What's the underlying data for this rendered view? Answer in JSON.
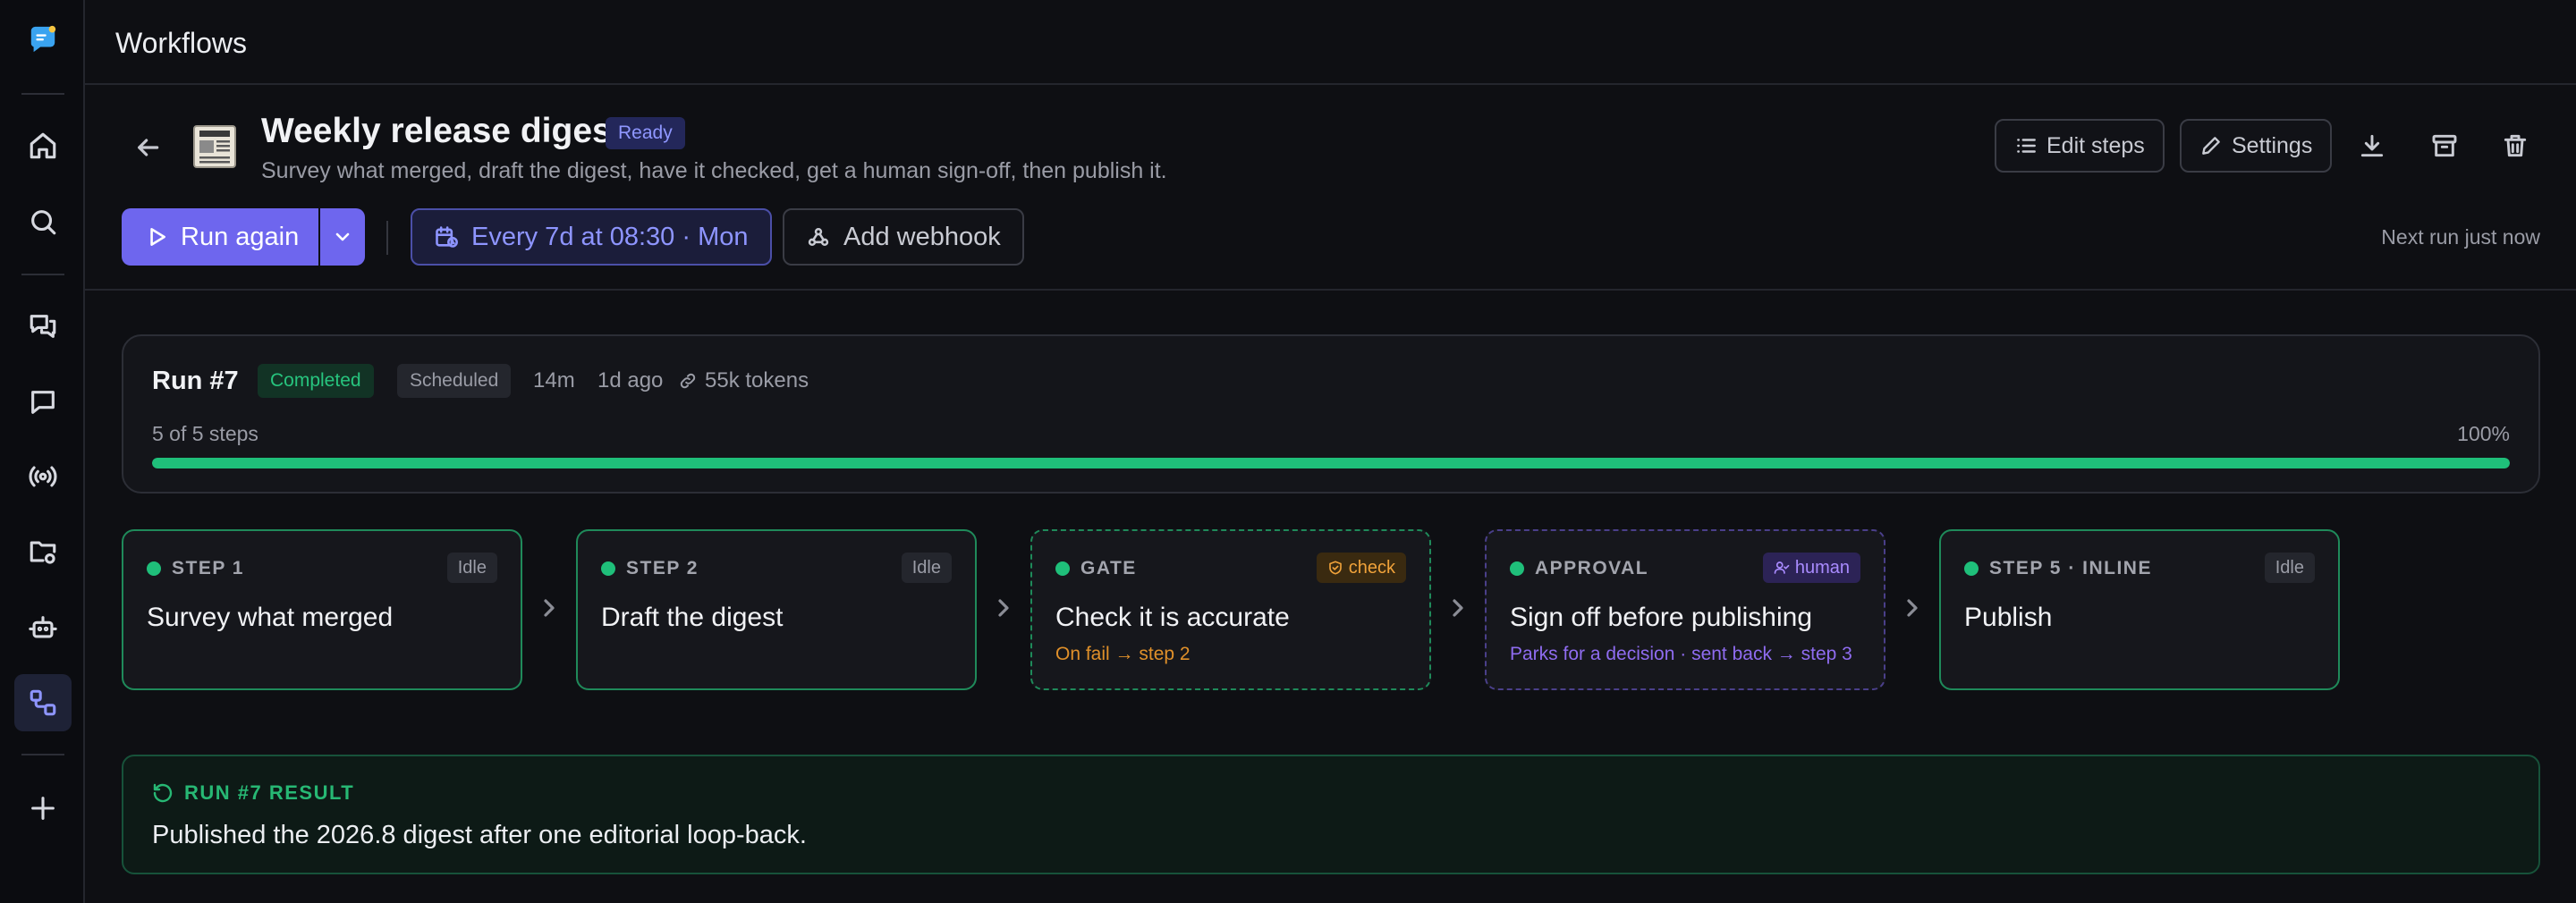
{
  "topbar": {
    "title": "Workflows"
  },
  "workflow": {
    "title": "Weekly release digest",
    "status": "Ready",
    "description": "Survey what merged, draft the digest, have it checked, get a human sign-off, then publish it.",
    "actions": {
      "edit_steps": "Edit steps",
      "settings": "Settings"
    }
  },
  "controls": {
    "run_again": "Run again",
    "schedule": "Every 7d at 08:30 · Mon",
    "add_webhook": "Add webhook",
    "next_run": "Next run just now"
  },
  "run": {
    "name": "Run #7",
    "status": "Completed",
    "trigger": "Scheduled",
    "duration": "14m",
    "ago": "1d ago",
    "tokens": "55k tokens",
    "steps_done": "5 of 5 steps",
    "progress_label": "100%",
    "progress": 1.0
  },
  "steps": [
    {
      "kind": "STEP 1",
      "tag": "Idle",
      "name": "Survey what merged",
      "note": ""
    },
    {
      "kind": "STEP 2",
      "tag": "Idle",
      "name": "Draft the digest",
      "note": ""
    },
    {
      "kind": "GATE",
      "tag": "check",
      "name": "Check it is accurate",
      "note": "On fail → step 2"
    },
    {
      "kind": "APPROVAL",
      "tag": "human",
      "name": "Sign off before publishing",
      "note": "Parks for a decision · sent back → step 3"
    },
    {
      "kind": "STEP 5 · INLINE",
      "tag": "Idle",
      "name": "Publish",
      "note": ""
    }
  ],
  "result": {
    "heading": "RUN #7 RESULT",
    "text": "Published the 2026.8 digest after one editorial loop-back."
  },
  "colors": {
    "accent": "#6e66ee",
    "success": "#1fbf7a",
    "warning": "#f0a23a",
    "human": "#a98bff"
  }
}
